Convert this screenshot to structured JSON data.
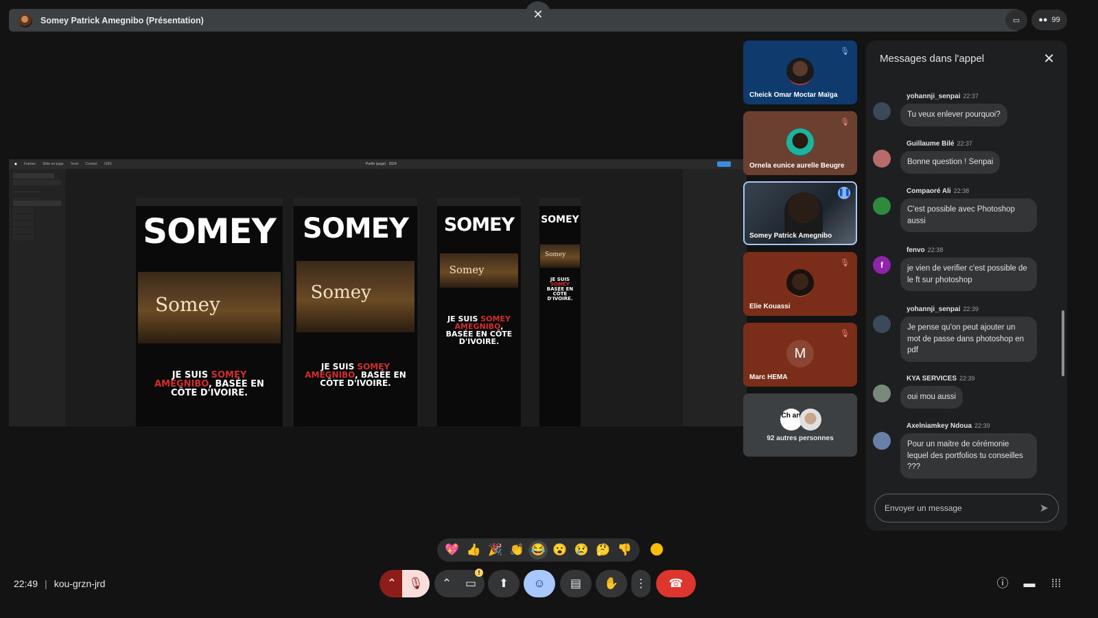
{
  "topbar": {
    "title": "Somey Patrick Amegnibo (Présentation)",
    "close_icon": "close-icon",
    "people_count": "99"
  },
  "shared_screen": {
    "toolbar_items": [
      "Frames",
      "Slide-en page",
      "Texts",
      "Contact",
      "CMS"
    ],
    "toolbar_center": "Portfo (page) · 2024",
    "mockups": [
      {
        "hero": "SOMEY",
        "photo_word": "Somey",
        "tagline_pre": "JE SUIS ",
        "tagline_red": "SOMEY AMEGNIBO",
        "tagline_post": ", BASÉE EN CÔTE D'IVOIRE."
      },
      {
        "hero": "SOMEY",
        "photo_word": "Somey",
        "tagline_pre": "JE SUIS ",
        "tagline_red": "SOMEY AMEGNIBO",
        "tagline_post": ", BASÉE EN CÔTE D'IVOIRE."
      },
      {
        "hero": "SOMEY",
        "photo_word": "Somey",
        "tagline_pre": "JE SUIS ",
        "tagline_red": "SOMEY AMEGNIBO",
        "tagline_post": ", BASÉE EN CÔTE D'IVOIRE."
      },
      {
        "hero": "SOMEY",
        "photo_word": "Somey",
        "tagline_pre": "JE SUIS ",
        "tagline_red": "SOMEY",
        "tagline_post": " BASÉE EN CÔTE D'IVOIRE."
      }
    ]
  },
  "participants": [
    {
      "name": "Cheick Omar Moctar Maïga",
      "muted": true
    },
    {
      "name": "Ornela eunice aurelle Beugre",
      "muted": true
    },
    {
      "name": "Somey Patrick Amegnibo",
      "muted": false,
      "speaking": true
    },
    {
      "name": "Elie Kouassi",
      "muted": true
    },
    {
      "name": "Marc HEMA",
      "initial": "M",
      "muted": true
    }
  ],
  "others": {
    "label": "92 autres personnes",
    "avatar_text": "Ch art"
  },
  "chat": {
    "title": "Messages dans l'appel",
    "messages": [
      {
        "sender": "yohannji_senpai",
        "time": "22:37",
        "text": "Tu veux enlever pourquoi?",
        "avatar_color": "#3b4a5a"
      },
      {
        "sender": "Guillaume Bilé",
        "time": "22:37",
        "text": "Bonne question ! Senpai",
        "avatar_color": "#b86b6b"
      },
      {
        "sender": "Compaoré Ali",
        "time": "22:38",
        "text": "C'est possible avec Photoshop aussi",
        "avatar_color": "#2e8b3e"
      },
      {
        "sender": "fenvo",
        "time": "22:38",
        "text": "je vien de verifier c'est possible de le ft sur photoshop",
        "avatar_color": "#8e24aa",
        "avatar_letter": "f"
      },
      {
        "sender": "yohannji_senpai",
        "time": "22:39",
        "text": "Je pense qu'on peut ajouter un mot de passe dans photoshop en pdf",
        "avatar_color": "#3b4a5a"
      },
      {
        "sender": "KYA SERVICES",
        "time": "22:39",
        "text": "oui mou aussi",
        "avatar_color": "#7a8a7a"
      },
      {
        "sender": "Axelniamkey Ndoua",
        "time": "22:39",
        "text": "Pour un maitre de cérémonie lequel des portfolios tu conseilles ???",
        "avatar_color": "#6a7fa8"
      }
    ],
    "input_placeholder": "Envoyer un message"
  },
  "reactions": [
    "💖",
    "👍",
    "🎉",
    "👏",
    "😂",
    "😮",
    "😢",
    "🤔",
    "👎"
  ],
  "meeting": {
    "time": "22:49",
    "code": "kou-grzn-jrd"
  }
}
